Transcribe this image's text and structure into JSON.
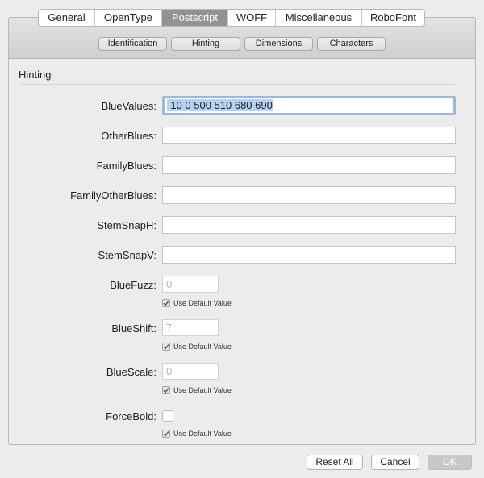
{
  "tabs": [
    "General",
    "OpenType",
    "Postscript",
    "WOFF",
    "Miscellaneous",
    "RoboFont"
  ],
  "active_tab": "Postscript",
  "subtabs": [
    "Identification",
    "Hinting",
    "Dimensions",
    "Characters"
  ],
  "section_title": "Hinting",
  "fields": {
    "blue_values": {
      "label": "BlueValues:",
      "value": "-10 0 500 510 680 690"
    },
    "other_blues": {
      "label": "OtherBlues:",
      "value": ""
    },
    "family_blues": {
      "label": "FamilyBlues:",
      "value": ""
    },
    "family_other_blues": {
      "label": "FamilyOtherBlues:",
      "value": ""
    },
    "stem_snap_h": {
      "label": "StemSnapH:",
      "value": ""
    },
    "stem_snap_v": {
      "label": "StemSnapV:",
      "value": ""
    },
    "blue_fuzz": {
      "label": "BlueFuzz:",
      "placeholder": "0",
      "use_default_label": "Use Default Value",
      "use_default_checked": true
    },
    "blue_shift": {
      "label": "BlueShift:",
      "placeholder": "7",
      "use_default_label": "Use Default Value",
      "use_default_checked": true
    },
    "blue_scale": {
      "label": "BlueScale:",
      "placeholder": "0",
      "use_default_label": "Use Default Value",
      "use_default_checked": true
    },
    "force_bold": {
      "label": "ForceBold:",
      "checked": false,
      "use_default_label": "Use Default Value",
      "use_default_checked": true
    }
  },
  "buttons": {
    "reset_all": "Reset All",
    "cancel": "Cancel",
    "ok": "OK"
  },
  "colors": {
    "active_tab": "#929292",
    "selection": "#b5d2f3",
    "focus_ring": "#9fb7d6"
  }
}
